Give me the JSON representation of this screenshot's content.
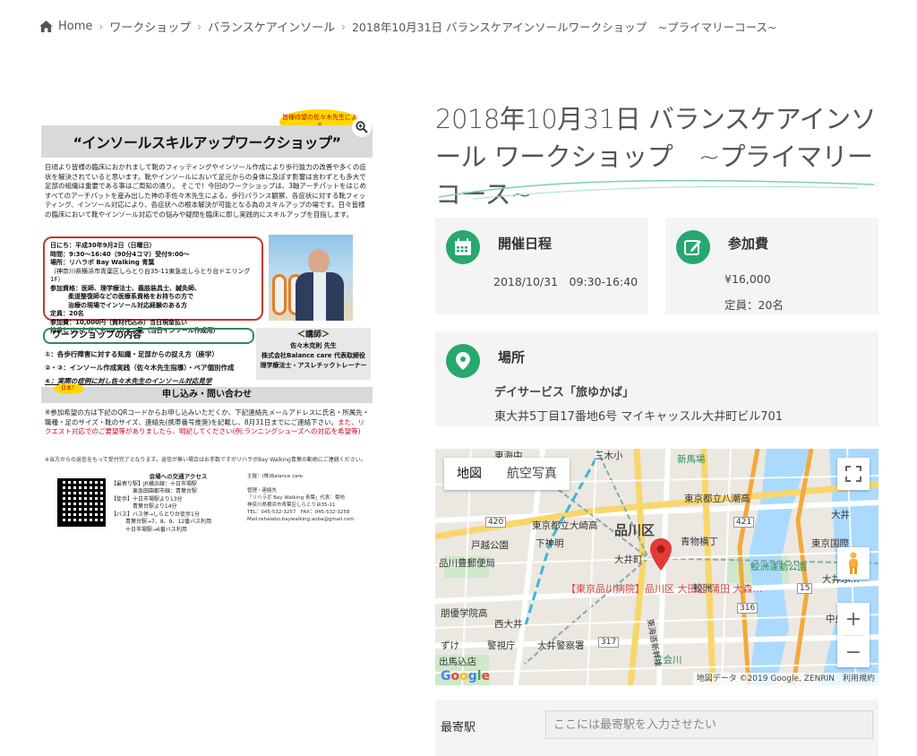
{
  "breadcrumb": {
    "home": "Home",
    "items": [
      "ワークショップ",
      "バランスケアインソール"
    ],
    "current": "2018年10月31日 バランスケアインソールワークショップ　~プライマリーコース~"
  },
  "flyer": {
    "bubble": "皆様待望の佐々木先生による",
    "title": "“インソールスキルアップワークショップ”",
    "intro": "日頃より皆様の臨床におかれまして靴のフィッティングやインソール作成により歩行能力の改善や多くの症状を解決されていると思います。靴やインソールにおいて足元からの身体に及ぼす影響は言わずとも多大で足部の組織は重要である事はご周知の通り。 そこで！今回のワークショップは、3軸アーチパットをはじめすべてのアーチパットを産み出した神の手佐々木先生による、歩行バランス観察、各症状に対する靴フィッティング、インソール対応により、各症状への根本解決が可能となる為のスキルアップの場です。日々皆様の臨床において靴やインソール対応での悩みや疑問を臨床に即し実践的にスキルアップを目指します。",
    "box_lines": [
      "日にち：平成30年9月2日（日曜日）",
      "時間：9:30～16:40（90分4コマ）受付9:00～",
      "場所：リハラボ Bay Walking 青葉",
      "（神奈川県横浜市青葉区しらとり台35-11東急北しらとり台ドエリング1F）",
      "参加資格：医師、理学療法士、義肢装具士、鍼灸師、",
      "柔道整復師などの医療系資格をお持ちの方で",
      "治療の現場でインソール対応経験のある方",
      "定員：20名",
      "参加費：10,000円（資材代込み）当日現金払い",
      "持参していただくものハサミ、靴（当日インソール作成用）"
    ],
    "section_title": "ワークショップの内容",
    "list": [
      "①：各歩行障害に対する知識・足部からの捉え方（座学）",
      "②・③：インソール作成実践（佐々木先生指導）・ペア個別作成",
      "④：実際の症例に対し佐々木先生のインソール対応見学"
    ],
    "lecturer": [
      "＜講師＞",
      "佐々木克則 先生",
      "株式会社Balance care 代表取締役",
      "理学療法士・アスレチックトレーナー"
    ],
    "apply_tag": "日本！",
    "apply_title": "申し込み・問い合わせ",
    "apply_text": "※参加希望の方は下記のQRコードからお申し込みいただくか、下記連絡先メールアドレスに氏名・所属先・職種・足のサイズ・靴のサイズ、連絡先(携帯番号推奨)を記載し、8月31日までにご連絡下さい。",
    "apply_text_red": "また、リクエスト対応でのご要望等がありましたら、明記してください(例:ランニングシューズへの対応を希望等)",
    "note": "※当方からの返信をもって受付完了となります。返信が無い場合はお手数ですがリハラボBay Walking青葉の動地にご連絡ください。",
    "access_title": "会場への交通アクセス",
    "access_lines": [
      "【最寄り駅】JR横浜線：十日市場駅",
      "東急田園都市線：青葉台駅",
      "【徒歩】十日市場駅より13分",
      "青葉台駅より14分",
      "【バス】バス停→しらとり台徒歩1分",
      "青葉台駅→7、8、9、12番バス利用",
      "十日市場駅→6番バス利用"
    ],
    "contact_lines": [
      "主催：(株)Balance care",
      "",
      "管理・連絡先",
      "「リハラボ Bay Walking 青葉」代表：菊地",
      "神奈川県横浜市青葉区しらとり台35-11",
      "TEL：045-532-3257　FAX：045-532-3258",
      "Mail:rehalabo.baywalking.aoba@gmail.com"
    ]
  },
  "event": {
    "title": "2018年10月31日 バランスケアインソール ワークショップ　~プライマリーコース~"
  },
  "cards": {
    "date": {
      "label": "開催日程",
      "value": "2018/10/31　09:30-16:40"
    },
    "fee": {
      "label": "参加費",
      "value": "¥16,000",
      "capacity": "定員：20名"
    },
    "place": {
      "label": "場所",
      "name": "デイサービス「旅ゆかば」",
      "address": "東大井5丁目17番地6号 マイキャッスル大井町ビル701"
    }
  },
  "map": {
    "tab_map": "地図",
    "tab_satellite": "航空写真",
    "labels": {
      "shinagawa_ku": "品川区",
      "oimachi": "大井町",
      "toyo_chu": "東海中",
      "mitsuki": "三木小",
      "shinbashi_st": "新馬場",
      "toritsu": "東京都立八潮高",
      "toritsu_ooi": "東京都立大崎高",
      "shimoshinmei": "下神明",
      "aomonoyokocho": "青物横丁",
      "samezu": "鮫洲運動公園",
      "tokogoshi_park": "戸越公園",
      "shinagawa_post": "品川豊郵便局",
      "hospital": "【東京品川病院】品川区 大田区 蒲田 大森…",
      "samezu_st": "鮫洲",
      "nishi_oi": "西大井",
      "oimachi_police": "大井警察署",
      "keisatsu": "警視庁",
      "tatekai": "立会川",
      "oi": "大井",
      "tokyo_kokusai": "東京国際",
      "oi_futo": "大井ふ…",
      "chuo": "中央",
      "road_420": "420",
      "road_421": "421",
      "road_317": "317",
      "road_316": "316",
      "road_15": "15",
      "tokaido": "東海道新幹線",
      "hilltop": "品川",
      "gakuen": "朋優学院高",
      "oimachi_st": "大井町",
      "parks": "ずけ",
      "park2": "出馬込店"
    },
    "footer": "地図データ ©2019 Google, ZENRIN　利用規約",
    "google": [
      "G",
      "o",
      "o",
      "g",
      "l",
      "e"
    ]
  },
  "station": {
    "label": "最寄駅",
    "placeholder": "ここには最寄駅を入力させたい"
  }
}
